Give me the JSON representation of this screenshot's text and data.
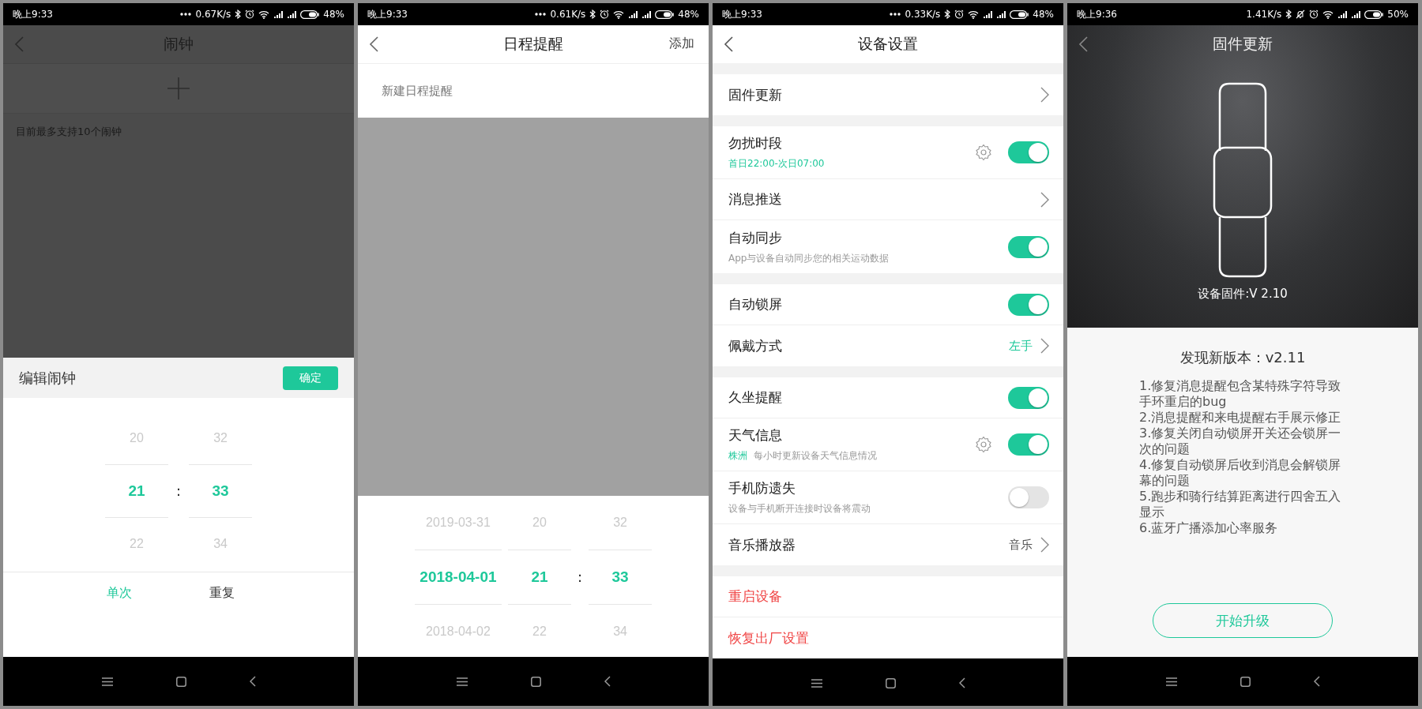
{
  "screens": [
    {
      "kind": "alarm",
      "status_bar": {
        "time": "晚上9:33",
        "more_indicator": true,
        "speed": "0.67K/s",
        "silent_mode": false,
        "battery": "48%"
      },
      "title": "闹钟",
      "note": "目前最多支持10个闹钟",
      "sheet": {
        "title": "编辑闹钟",
        "confirm": "确定",
        "separator": ":",
        "columns": [
          {
            "items": [
              {
                "text": "20",
                "selected": false
              },
              {
                "text": "21",
                "selected": true
              },
              {
                "text": "22",
                "selected": false
              }
            ]
          },
          {
            "items": [
              {
                "text": "32",
                "selected": false
              },
              {
                "text": "33",
                "selected": true
              },
              {
                "text": "34",
                "selected": false
              }
            ]
          }
        ],
        "modes": [
          {
            "label": "单次",
            "selected": true
          },
          {
            "label": "重复",
            "selected": false
          }
        ]
      }
    },
    {
      "kind": "schedule",
      "status_bar": {
        "time": "晚上9:33",
        "more_indicator": true,
        "speed": "0.61K/s",
        "silent_mode": false,
        "battery": "48%"
      },
      "title": "日程提醒",
      "action": "添加",
      "new_item": "新建日程提醒",
      "picker": {
        "separator": ":",
        "columns": [
          {
            "kind": "date",
            "items": [
              {
                "text": "2019-03-31",
                "selected": false
              },
              {
                "text": "2018-04-01",
                "selected": true
              },
              {
                "text": "2018-04-02",
                "selected": false
              }
            ]
          },
          {
            "kind": "hour",
            "items": [
              {
                "text": "20",
                "selected": false
              },
              {
                "text": "21",
                "selected": true
              },
              {
                "text": "22",
                "selected": false
              }
            ]
          },
          {
            "kind": "minute",
            "items": [
              {
                "text": "32",
                "selected": false
              },
              {
                "text": "33",
                "selected": true
              },
              {
                "text": "34",
                "selected": false
              }
            ]
          }
        ]
      }
    },
    {
      "kind": "settings",
      "status_bar": {
        "time": "晚上9:33",
        "more_indicator": true,
        "speed": "0.33K/s",
        "silent_mode": false,
        "battery": "48%"
      },
      "title": "设备设置",
      "groups": [
        {
          "items": [
            {
              "kind": "link",
              "label": "固件更新"
            }
          ]
        },
        {
          "items": [
            {
              "kind": "toggle",
              "label": "勿扰时段",
              "subtitle": "首日22:00-次日07:00",
              "subtitle_accent": true,
              "gear": true,
              "on": true
            },
            {
              "kind": "link",
              "label": "消息推送"
            },
            {
              "kind": "toggle",
              "label": "自动同步",
              "subtitle": "App与设备自动同步您的相关运动数据",
              "on": true
            }
          ]
        },
        {
          "items": [
            {
              "kind": "toggle",
              "label": "自动锁屏",
              "on": true
            },
            {
              "kind": "link",
              "label": "佩戴方式",
              "value": "左手",
              "value_accent": true
            }
          ]
        },
        {
          "items": [
            {
              "kind": "toggle",
              "label": "久坐提醒",
              "on": true
            },
            {
              "kind": "toggle",
              "label": "天气信息",
              "location": "株洲",
              "subtitle": "每小时更新设备天气信息情况",
              "gear": true,
              "on": true
            },
            {
              "kind": "toggle",
              "label": "手机防遗失",
              "subtitle": "设备与手机断开连接时设备将震动",
              "on": false
            },
            {
              "kind": "link",
              "label": "音乐播放器",
              "value": "音乐",
              "value_accent": false
            }
          ]
        },
        {
          "items": [
            {
              "kind": "action",
              "label": "重启设备"
            },
            {
              "kind": "action",
              "label": "恢复出厂设置"
            }
          ]
        }
      ]
    },
    {
      "kind": "firmware",
      "status_bar": {
        "time": "晚上9:36",
        "more_indicator": false,
        "speed": "1.41K/s",
        "silent_mode": true,
        "battery": "50%"
      },
      "title": "固件更新",
      "current": "设备固件:V 2.10",
      "heading": "发现新版本：v2.11",
      "notes": [
        "1.修复消息提醒包含某特殊字符导致手环重启的bug",
        "2.消息提醒和来电提醒右手展示修正",
        "3.修复关闭自动锁屏开关还会锁屏一次的问题",
        "4.修复自动锁屏后收到消息会解锁屏幕的问题",
        "5.跑步和骑行结算距离进行四舍五入显示",
        "6.蓝牙广播添加心率服务"
      ],
      "button": "开始升级"
    }
  ]
}
